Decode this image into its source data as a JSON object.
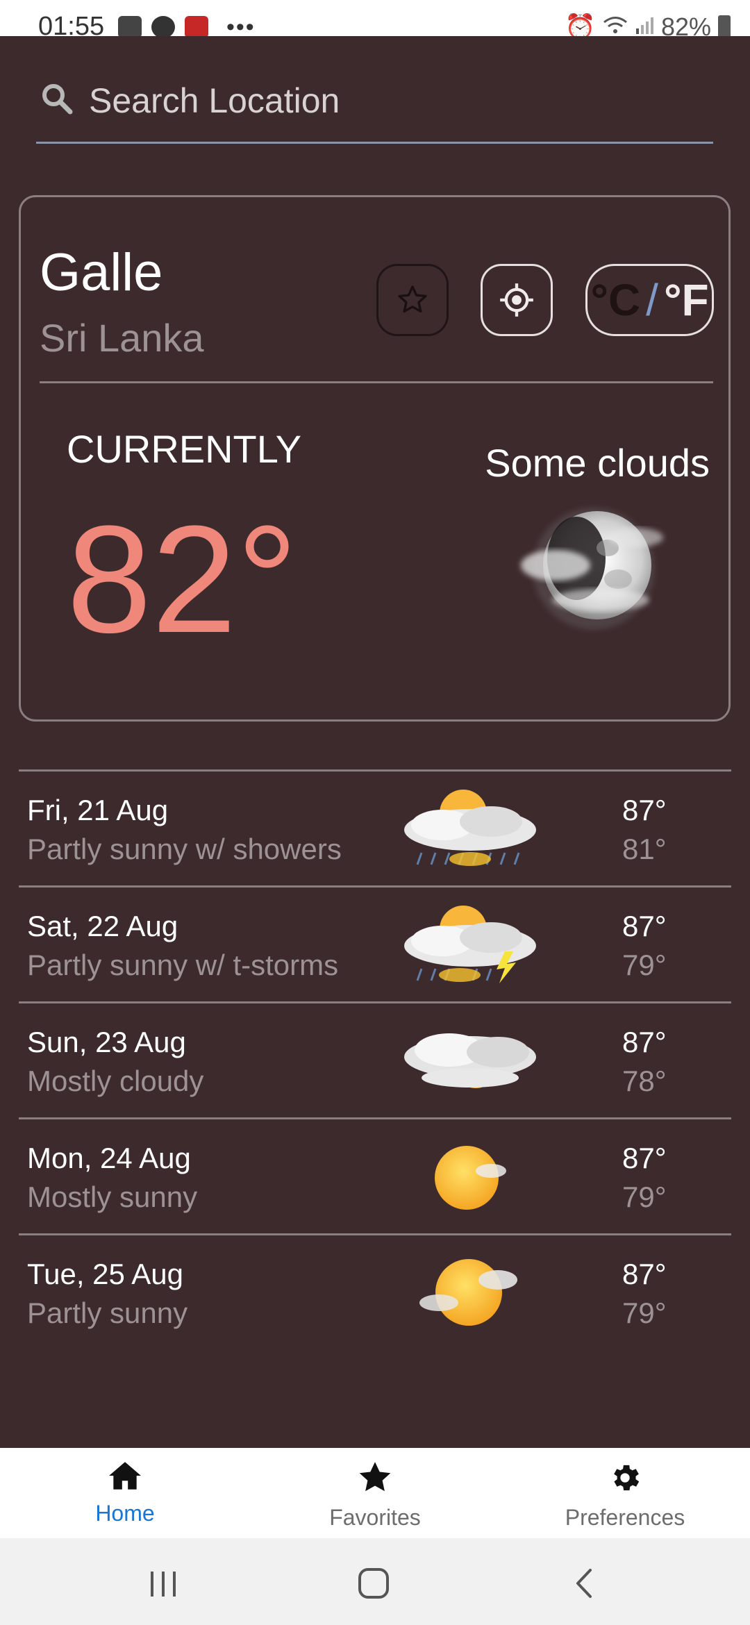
{
  "status_bar": {
    "time": "01:55",
    "battery": "82%"
  },
  "search": {
    "placeholder": "Search Location"
  },
  "current": {
    "city": "Galle",
    "country": "Sri Lanka",
    "unit_c": "°C",
    "unit_sep": "/",
    "unit_f": "°F",
    "label": "CURRENTLY",
    "temperature": "82°",
    "condition": "Some clouds",
    "condition_icon": "moon-clouds-icon"
  },
  "forecast": [
    {
      "date": "Fri, 21 Aug",
      "desc": "Partly sunny w/ showers",
      "hi": "87°",
      "lo": "81°",
      "icon": "sun-cloud-rain-icon"
    },
    {
      "date": "Sat, 22 Aug",
      "desc": "Partly sunny w/ t-storms",
      "hi": "87°",
      "lo": "79°",
      "icon": "sun-cloud-storm-icon"
    },
    {
      "date": "Sun, 23 Aug",
      "desc": "Mostly cloudy",
      "hi": "87°",
      "lo": "78°",
      "icon": "cloud-sun-icon"
    },
    {
      "date": "Mon, 24 Aug",
      "desc": "Mostly sunny",
      "hi": "87°",
      "lo": "79°",
      "icon": "sun-icon"
    },
    {
      "date": "Tue, 25 Aug",
      "desc": "Partly sunny",
      "hi": "87°",
      "lo": "79°",
      "icon": "sun-small-cloud-icon"
    }
  ],
  "nav": {
    "home": "Home",
    "favorites": "Favorites",
    "preferences": "Preferences",
    "active": "home",
    "active_color": "#1976d2"
  },
  "colors": {
    "background": "#3d2a2c",
    "temperature": "#f0877b",
    "secondary_text": "#9d9294"
  }
}
